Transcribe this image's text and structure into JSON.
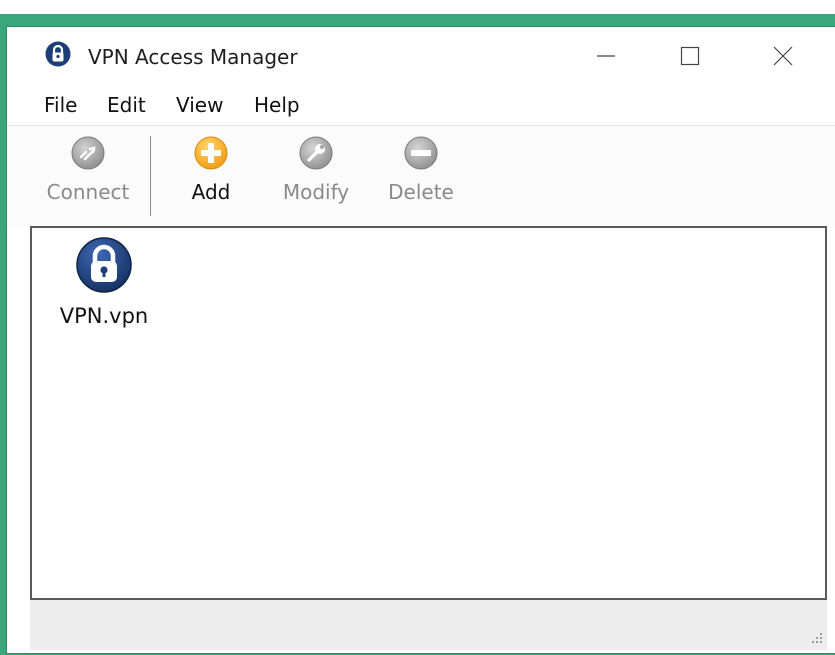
{
  "window": {
    "title": "VPN Access Manager",
    "controls": {
      "minimize": "—",
      "maximize": "☐",
      "close": "✕"
    }
  },
  "menubar": {
    "items": [
      "File",
      "Edit",
      "View",
      "Help"
    ]
  },
  "toolbar": {
    "buttons": [
      {
        "label": "Connect",
        "icon": "connect-icon",
        "enabled": false
      },
      {
        "label": "Add",
        "icon": "add-icon",
        "enabled": true
      },
      {
        "label": "Modify",
        "icon": "modify-icon",
        "enabled": false
      },
      {
        "label": "Delete",
        "icon": "delete-icon",
        "enabled": false
      }
    ]
  },
  "content": {
    "files": [
      {
        "name": "VPN.vpn",
        "icon": "vpn-lock-icon"
      }
    ]
  },
  "colors": {
    "desktop": "#3aa67a",
    "lock_blue": "#1d3f77",
    "add_orange": "#f5a623",
    "disabled_gray": "#8a8a8a"
  }
}
